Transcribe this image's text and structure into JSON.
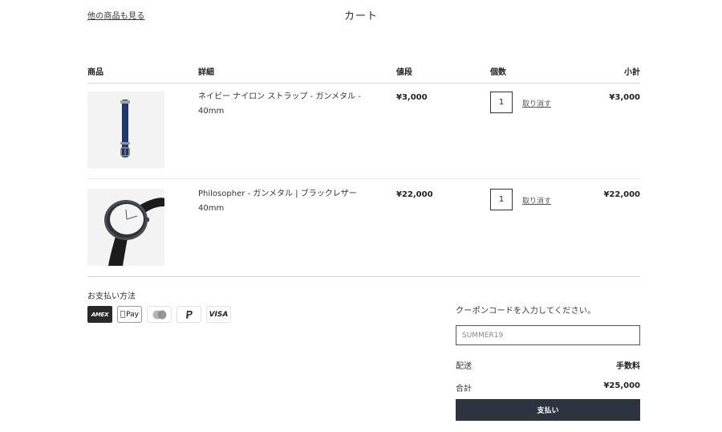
{
  "header": {
    "continue_shopping": "他の商品も見る",
    "title": "カート"
  },
  "columns": {
    "product": "商品",
    "detail": "詳細",
    "price": "値段",
    "quantity": "個数",
    "subtotal": "小計"
  },
  "items": [
    {
      "name": "ネイビー ナイロン ストラップ - ガンメタル - 40mm",
      "name_line2": "",
      "price": "¥3,000",
      "quantity": "1",
      "remove": "取り消す",
      "subtotal": "¥3,000",
      "image_icon": "navy-nylon-strap-image"
    },
    {
      "name": "Philosopher - ガンメタル | ブラックレザー",
      "name_line2": "40mm",
      "price": "¥22,000",
      "quantity": "1",
      "remove": "取り消す",
      "subtotal": "¥22,000",
      "image_icon": "philosopher-watch-image"
    }
  ],
  "payment": {
    "label": "お支払い方法",
    "methods": [
      "AMEX",
      "Pay",
      "mastercard-icon",
      "paypal-icon",
      "VISA"
    ]
  },
  "coupon": {
    "label": "クーポンコードを入力してください。",
    "placeholder": "SUMMER19",
    "value": ""
  },
  "summary": {
    "shipping_label": "配送",
    "shipping_value": "手数料",
    "total_label": "合計",
    "total_value": "¥25,000"
  },
  "checkout": {
    "label": "支払い"
  },
  "colors": {
    "checkout_bg": "#2c3440",
    "strap_navy": "#1e2f5c",
    "text": "#333333"
  }
}
